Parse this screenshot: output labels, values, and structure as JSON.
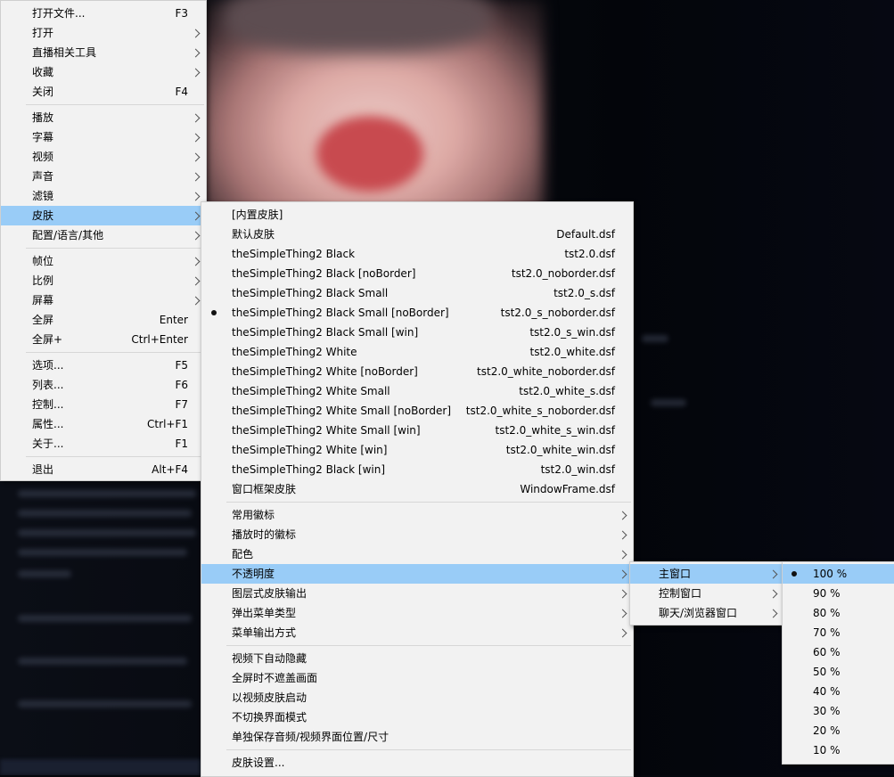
{
  "main_menu": {
    "group1": [
      {
        "label": "打开文件...",
        "shortcut": "F3"
      },
      {
        "label": "打开",
        "submenu": true
      },
      {
        "label": "直播相关工具",
        "submenu": true
      },
      {
        "label": "收藏",
        "submenu": true
      },
      {
        "label": "关闭",
        "shortcut": "F4"
      }
    ],
    "group2": [
      {
        "label": "播放",
        "submenu": true
      },
      {
        "label": "字幕",
        "submenu": true
      },
      {
        "label": "视频",
        "submenu": true
      },
      {
        "label": "声音",
        "submenu": true
      },
      {
        "label": "滤镜",
        "submenu": true
      },
      {
        "label": "皮肤",
        "submenu": true,
        "highlighted": true
      },
      {
        "label": "配置/语言/其他",
        "submenu": true
      }
    ],
    "group3": [
      {
        "label": "帧位",
        "submenu": true
      },
      {
        "label": "比例",
        "submenu": true
      },
      {
        "label": "屏幕",
        "submenu": true
      },
      {
        "label": "全屏",
        "shortcut": "Enter"
      },
      {
        "label": "全屏+",
        "shortcut": "Ctrl+Enter"
      }
    ],
    "group4": [
      {
        "label": "选项...",
        "shortcut": "F5"
      },
      {
        "label": "列表...",
        "shortcut": "F6"
      },
      {
        "label": "控制...",
        "shortcut": "F7"
      },
      {
        "label": "属性...",
        "shortcut": "Ctrl+F1"
      },
      {
        "label": "关于...",
        "shortcut": "F1"
      }
    ],
    "group5": [
      {
        "label": "退出",
        "shortcut": "Alt+F4"
      }
    ]
  },
  "skin_menu": {
    "skins": [
      {
        "label": "[内置皮肤]",
        "file": ""
      },
      {
        "label": "默认皮肤",
        "file": "Default.dsf"
      },
      {
        "label": "theSimpleThing2 Black",
        "file": "tst2.0.dsf"
      },
      {
        "label": "theSimpleThing2 Black [noBorder]",
        "file": "tst2.0_noborder.dsf"
      },
      {
        "label": "theSimpleThing2 Black Small",
        "file": "tst2.0_s.dsf"
      },
      {
        "label": "theSimpleThing2 Black Small [noBorder]",
        "file": "tst2.0_s_noborder.dsf",
        "selected": true
      },
      {
        "label": "theSimpleThing2 Black Small [win]",
        "file": "tst2.0_s_win.dsf"
      },
      {
        "label": "theSimpleThing2 White",
        "file": "tst2.0_white.dsf"
      },
      {
        "label": "theSimpleThing2 White [noBorder]",
        "file": "tst2.0_white_noborder.dsf"
      },
      {
        "label": "theSimpleThing2 White Small",
        "file": "tst2.0_white_s.dsf"
      },
      {
        "label": "theSimpleThing2 White Small [noBorder]",
        "file": "tst2.0_white_s_noborder.dsf"
      },
      {
        "label": "theSimpleThing2 White Small [win]",
        "file": "tst2.0_white_s_win.dsf"
      },
      {
        "label": "theSimpleThing2 White [win]",
        "file": "tst2.0_white_win.dsf"
      },
      {
        "label": "theSimpleThing2 Black [win]",
        "file": "tst2.0_win.dsf"
      },
      {
        "label": "窗口框架皮肤",
        "file": "WindowFrame.dsf"
      }
    ],
    "group2": [
      {
        "label": "常用徽标",
        "submenu": true
      },
      {
        "label": "播放时的徽标",
        "submenu": true
      },
      {
        "label": "配色",
        "submenu": true
      },
      {
        "label": "不透明度",
        "submenu": true,
        "highlighted": true
      },
      {
        "label": "图层式皮肤输出",
        "submenu": true
      },
      {
        "label": "弹出菜单类型",
        "submenu": true
      },
      {
        "label": "菜单输出方式",
        "submenu": true
      }
    ],
    "group3": [
      {
        "label": "视频下自动隐藏"
      },
      {
        "label": "全屏时不遮盖画面"
      },
      {
        "label": "以视频皮肤启动"
      },
      {
        "label": "不切换界面模式"
      },
      {
        "label": "单独保存音频/视频界面位置/尺寸"
      }
    ],
    "group4": [
      {
        "label": "皮肤设置..."
      }
    ]
  },
  "opacity_menu": {
    "items": [
      {
        "label": "主窗口",
        "submenu": true,
        "highlighted": true
      },
      {
        "label": "控制窗口",
        "submenu": true
      },
      {
        "label": "聊天/浏览器窗口",
        "submenu": true
      }
    ]
  },
  "opacity_levels": {
    "selected_index": 0,
    "items": [
      "100 %",
      "90 %",
      "80 %",
      "70 %",
      "60 %",
      "50 %",
      "40 %",
      "30 %",
      "20 %",
      "10 %"
    ]
  },
  "colors": {
    "highlight": "#99ccf7",
    "menu_bg": "#f2f2f2"
  }
}
